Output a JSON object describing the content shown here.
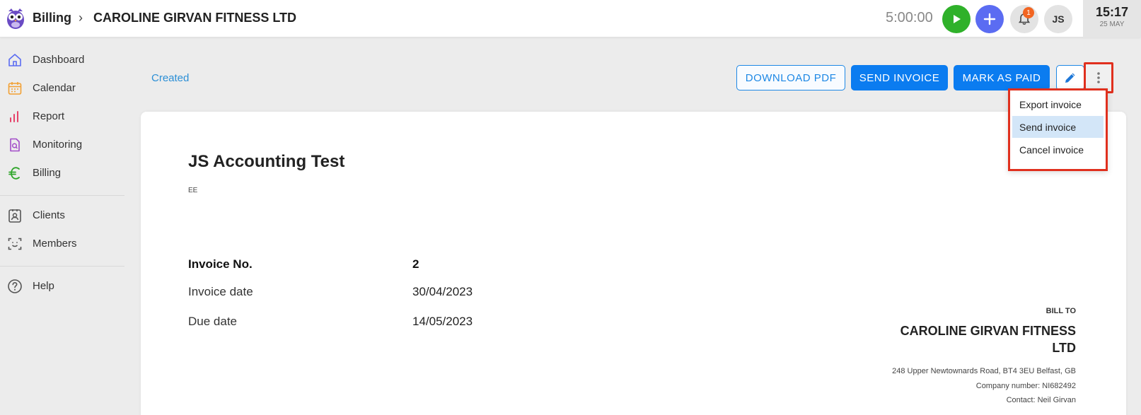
{
  "header": {
    "breadcrumb_root": "Billing",
    "breadcrumb_separator": "›",
    "breadcrumb_current": "CAROLINE GIRVAN FITNESS LTD",
    "timer": "5:00:00",
    "notification_count": "1",
    "avatar_initials": "JS",
    "clock_time": "15:17",
    "clock_date": "25 MAY"
  },
  "sidebar": {
    "items": [
      {
        "label": "Dashboard",
        "icon": "home-icon"
      },
      {
        "label": "Calendar",
        "icon": "calendar-icon"
      },
      {
        "label": "Report",
        "icon": "bar-chart-icon"
      },
      {
        "label": "Monitoring",
        "icon": "monitoring-icon"
      },
      {
        "label": "Billing",
        "icon": "euro-icon"
      },
      {
        "label": "Clients",
        "icon": "clients-icon"
      },
      {
        "label": "Members",
        "icon": "members-icon"
      },
      {
        "label": "Help",
        "icon": "help-icon"
      }
    ]
  },
  "toolbar": {
    "status": "Created",
    "download_pdf": "DOWNLOAD PDF",
    "send_invoice": "SEND INVOICE",
    "mark_as_paid": "MARK AS PAID"
  },
  "menu": {
    "items": [
      "Export invoice",
      "Send invoice",
      "Cancel invoice"
    ],
    "highlighted_index": 1
  },
  "invoice": {
    "company_name": "JS Accounting Test",
    "company_sub": "EE",
    "number_label": "Invoice No.",
    "number_value": "2",
    "date_label": "Invoice date",
    "date_value": "30/04/2023",
    "due_label": "Due date",
    "due_value": "14/05/2023",
    "bill_to_title": "BILL TO",
    "bill_to_name": "CAROLINE GIRVAN FITNESS LTD",
    "bill_to_address": "248 Upper Newtownards Road, BT4 3EU Belfast, GB",
    "bill_to_company_number": "Company number: NI682492",
    "bill_to_contact": "Contact: Neil Girvan"
  },
  "colors": {
    "primary": "#0b7cf0",
    "status_link": "#2b8fd6",
    "play": "#2fb12a",
    "add": "#5b6cf2",
    "badge": "#f26522",
    "highlight_box": "#e0301e"
  }
}
